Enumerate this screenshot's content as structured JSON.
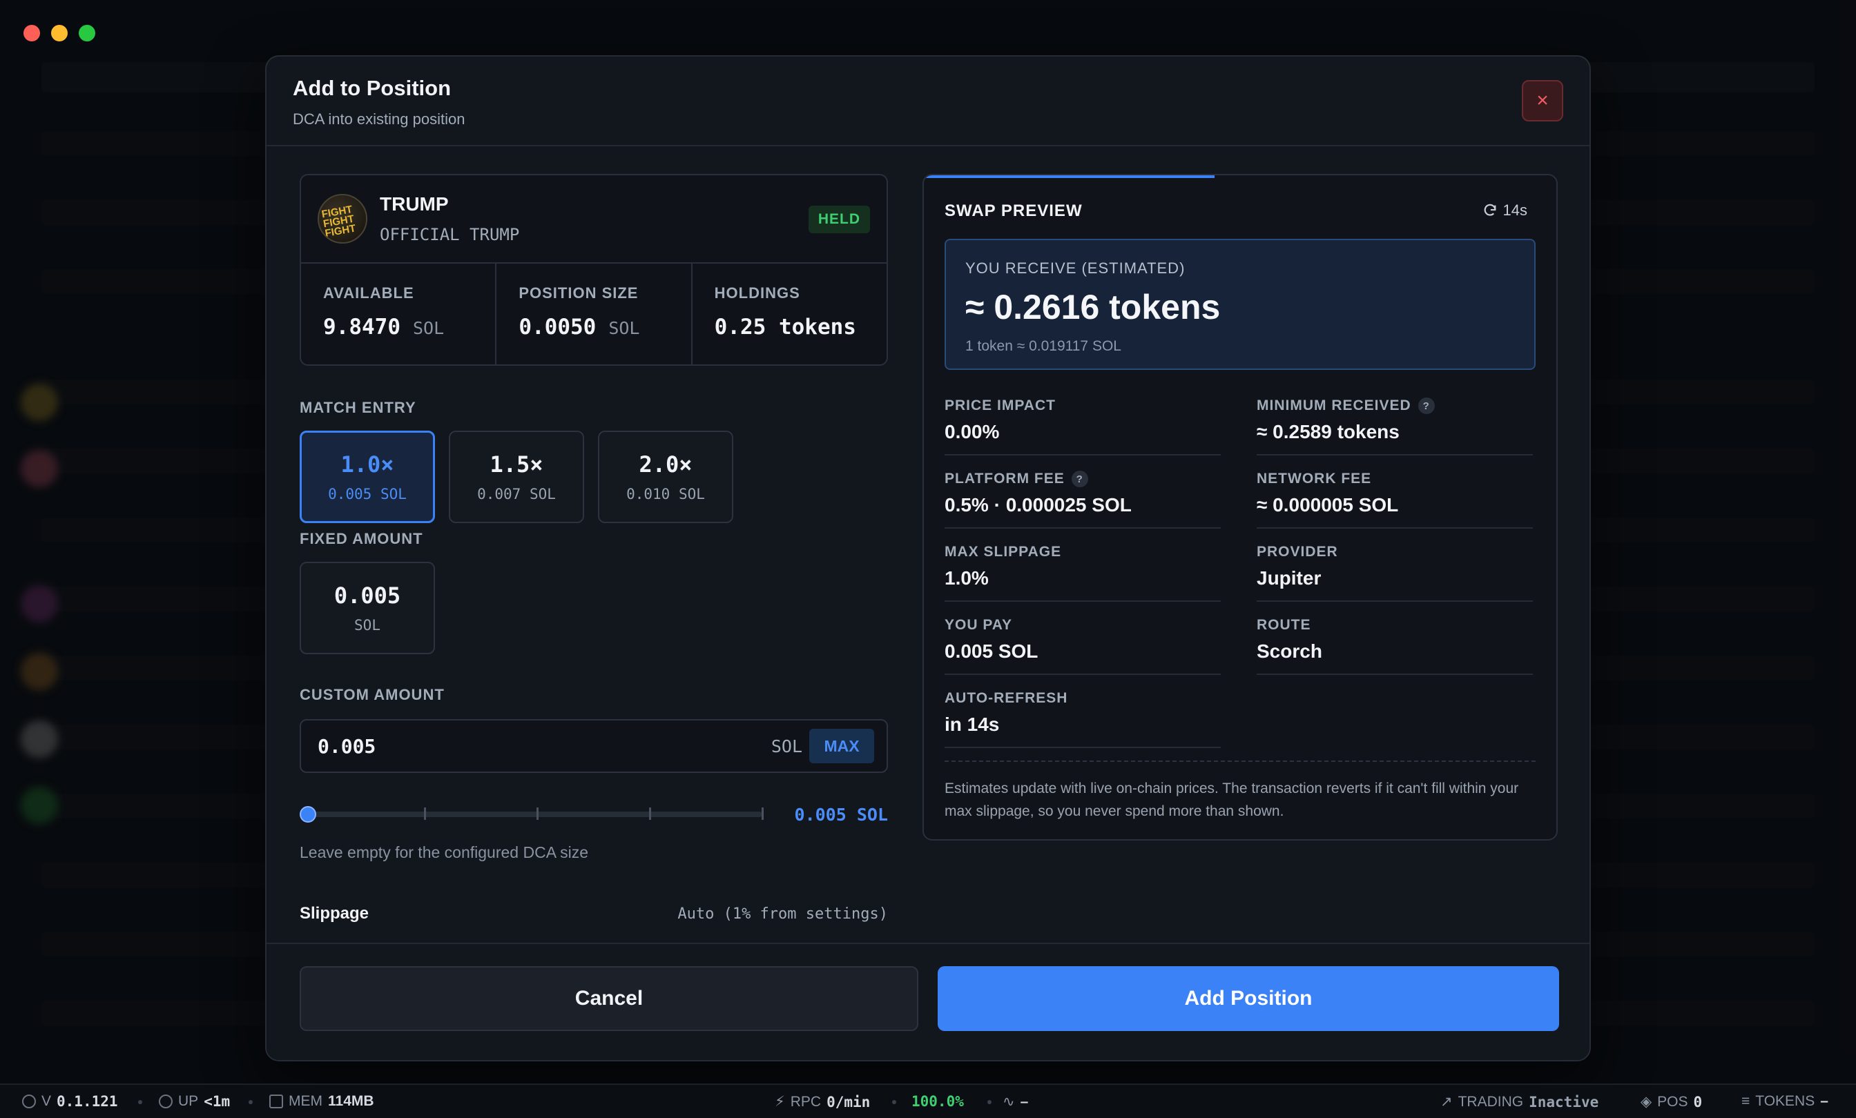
{
  "modal": {
    "title": "Add to Position",
    "subtitle": "DCA into existing position",
    "close_icon": "×"
  },
  "token": {
    "symbol": "TRUMP",
    "name": "OFFICIAL TRUMP",
    "badge": "HELD",
    "avatar_text": "FIGHT FIGHT FIGHT",
    "stats": [
      {
        "label": "AVAILABLE",
        "value": "9.8470",
        "unit": "SOL"
      },
      {
        "label": "POSITION SIZE",
        "value": "0.0050",
        "unit": "SOL"
      },
      {
        "label": "HOLDINGS",
        "value": "0.25 tokens",
        "unit": ""
      }
    ]
  },
  "match_entry": {
    "label": "MATCH ENTRY",
    "options": [
      {
        "mult": "1.0×",
        "sub": "0.005 SOL",
        "active": true
      },
      {
        "mult": "1.5×",
        "sub": "0.007 SOL",
        "active": false
      },
      {
        "mult": "2.0×",
        "sub": "0.010 SOL",
        "active": false
      }
    ]
  },
  "fixed_amount": {
    "label": "FIXED AMOUNT",
    "value": "0.005",
    "unit": "SOL"
  },
  "custom_amount": {
    "label": "CUSTOM AMOUNT",
    "value": "0.005",
    "unit": "SOL",
    "max_label": "MAX",
    "slider_value": "0.005 SOL",
    "slider_fraction": 0.0,
    "hint": "Leave empty for the configured DCA size"
  },
  "slippage": {
    "label": "Slippage",
    "value": "Auto (1% from settings)"
  },
  "preview": {
    "title": "SWAP PREVIEW",
    "refresh": "14s",
    "refresh_progress": 0.46,
    "receive_label": "YOU RECEIVE (ESTIMATED)",
    "receive_value": "≈ 0.2616 tokens",
    "receive_rate": "1 token ≈ 0.019117 SOL",
    "rows": [
      {
        "label": "PRICE IMPACT",
        "value": "0.00%",
        "help": false
      },
      {
        "label": "MINIMUM RECEIVED",
        "value": "≈ 0.2589 tokens",
        "help": true
      },
      {
        "label": "PLATFORM FEE",
        "value": "0.5% · 0.000025 SOL",
        "help": true
      },
      {
        "label": "NETWORK FEE",
        "value": "≈ 0.000005 SOL",
        "help": false
      },
      {
        "label": "MAX SLIPPAGE",
        "value": "1.0%",
        "help": false
      },
      {
        "label": "PROVIDER",
        "value": "Jupiter",
        "help": false
      },
      {
        "label": "YOU PAY",
        "value": "0.005 SOL",
        "help": false
      },
      {
        "label": "ROUTE",
        "value": "Scorch",
        "help": false
      },
      {
        "label": "AUTO-REFRESH",
        "value": "in 14s",
        "help": false
      }
    ],
    "note": "Estimates update with live on-chain prices. The transaction reverts if it can't fill within your max slippage, so you never spend more than shown."
  },
  "footer": {
    "cancel": "Cancel",
    "add": "Add Position"
  },
  "statusbar": {
    "version_label": "V",
    "version": "0.1.121",
    "uptime_label": "UP",
    "uptime": "<1m",
    "mem_label": "MEM",
    "mem": "114MB",
    "rpc_label": "RPC",
    "rpc": "0/min",
    "success": "100.0%",
    "latency": "–",
    "trading_label": "TRADING",
    "trading": "Inactive",
    "pos_label": "POS",
    "pos": "0",
    "tokens_label": "TOKENS",
    "tokens": "–"
  },
  "colors": {
    "accent": "#3b82f6",
    "success": "#3fcf71",
    "danger": "#f05d63"
  }
}
